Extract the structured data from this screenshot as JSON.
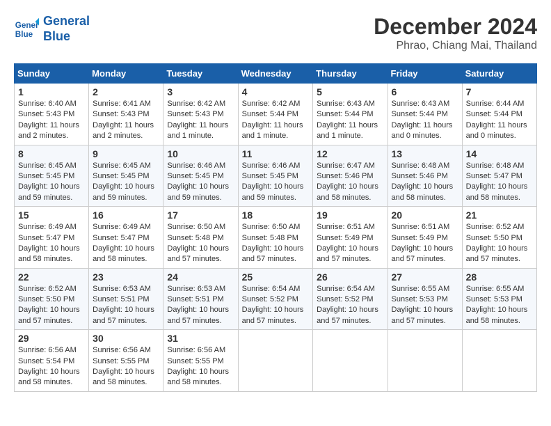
{
  "header": {
    "logo_line1": "General",
    "logo_line2": "Blue",
    "title": "December 2024",
    "subtitle": "Phrao, Chiang Mai, Thailand"
  },
  "weekdays": [
    "Sunday",
    "Monday",
    "Tuesday",
    "Wednesday",
    "Thursday",
    "Friday",
    "Saturday"
  ],
  "weeks": [
    [
      {
        "day": "1",
        "sunrise": "6:40 AM",
        "sunset": "5:43 PM",
        "daylight": "11 hours and 2 minutes."
      },
      {
        "day": "2",
        "sunrise": "6:41 AM",
        "sunset": "5:43 PM",
        "daylight": "11 hours and 2 minutes."
      },
      {
        "day": "3",
        "sunrise": "6:42 AM",
        "sunset": "5:43 PM",
        "daylight": "11 hours and 1 minute."
      },
      {
        "day": "4",
        "sunrise": "6:42 AM",
        "sunset": "5:44 PM",
        "daylight": "11 hours and 1 minute."
      },
      {
        "day": "5",
        "sunrise": "6:43 AM",
        "sunset": "5:44 PM",
        "daylight": "11 hours and 1 minute."
      },
      {
        "day": "6",
        "sunrise": "6:43 AM",
        "sunset": "5:44 PM",
        "daylight": "11 hours and 0 minutes."
      },
      {
        "day": "7",
        "sunrise": "6:44 AM",
        "sunset": "5:44 PM",
        "daylight": "11 hours and 0 minutes."
      }
    ],
    [
      {
        "day": "8",
        "sunrise": "6:45 AM",
        "sunset": "5:45 PM",
        "daylight": "10 hours and 59 minutes."
      },
      {
        "day": "9",
        "sunrise": "6:45 AM",
        "sunset": "5:45 PM",
        "daylight": "10 hours and 59 minutes."
      },
      {
        "day": "10",
        "sunrise": "6:46 AM",
        "sunset": "5:45 PM",
        "daylight": "10 hours and 59 minutes."
      },
      {
        "day": "11",
        "sunrise": "6:46 AM",
        "sunset": "5:45 PM",
        "daylight": "10 hours and 59 minutes."
      },
      {
        "day": "12",
        "sunrise": "6:47 AM",
        "sunset": "5:46 PM",
        "daylight": "10 hours and 58 minutes."
      },
      {
        "day": "13",
        "sunrise": "6:48 AM",
        "sunset": "5:46 PM",
        "daylight": "10 hours and 58 minutes."
      },
      {
        "day": "14",
        "sunrise": "6:48 AM",
        "sunset": "5:47 PM",
        "daylight": "10 hours and 58 minutes."
      }
    ],
    [
      {
        "day": "15",
        "sunrise": "6:49 AM",
        "sunset": "5:47 PM",
        "daylight": "10 hours and 58 minutes."
      },
      {
        "day": "16",
        "sunrise": "6:49 AM",
        "sunset": "5:47 PM",
        "daylight": "10 hours and 58 minutes."
      },
      {
        "day": "17",
        "sunrise": "6:50 AM",
        "sunset": "5:48 PM",
        "daylight": "10 hours and 57 minutes."
      },
      {
        "day": "18",
        "sunrise": "6:50 AM",
        "sunset": "5:48 PM",
        "daylight": "10 hours and 57 minutes."
      },
      {
        "day": "19",
        "sunrise": "6:51 AM",
        "sunset": "5:49 PM",
        "daylight": "10 hours and 57 minutes."
      },
      {
        "day": "20",
        "sunrise": "6:51 AM",
        "sunset": "5:49 PM",
        "daylight": "10 hours and 57 minutes."
      },
      {
        "day": "21",
        "sunrise": "6:52 AM",
        "sunset": "5:50 PM",
        "daylight": "10 hours and 57 minutes."
      }
    ],
    [
      {
        "day": "22",
        "sunrise": "6:52 AM",
        "sunset": "5:50 PM",
        "daylight": "10 hours and 57 minutes."
      },
      {
        "day": "23",
        "sunrise": "6:53 AM",
        "sunset": "5:51 PM",
        "daylight": "10 hours and 57 minutes."
      },
      {
        "day": "24",
        "sunrise": "6:53 AM",
        "sunset": "5:51 PM",
        "daylight": "10 hours and 57 minutes."
      },
      {
        "day": "25",
        "sunrise": "6:54 AM",
        "sunset": "5:52 PM",
        "daylight": "10 hours and 57 minutes."
      },
      {
        "day": "26",
        "sunrise": "6:54 AM",
        "sunset": "5:52 PM",
        "daylight": "10 hours and 57 minutes."
      },
      {
        "day": "27",
        "sunrise": "6:55 AM",
        "sunset": "5:53 PM",
        "daylight": "10 hours and 57 minutes."
      },
      {
        "day": "28",
        "sunrise": "6:55 AM",
        "sunset": "5:53 PM",
        "daylight": "10 hours and 58 minutes."
      }
    ],
    [
      {
        "day": "29",
        "sunrise": "6:56 AM",
        "sunset": "5:54 PM",
        "daylight": "10 hours and 58 minutes."
      },
      {
        "day": "30",
        "sunrise": "6:56 AM",
        "sunset": "5:55 PM",
        "daylight": "10 hours and 58 minutes."
      },
      {
        "day": "31",
        "sunrise": "6:56 AM",
        "sunset": "5:55 PM",
        "daylight": "10 hours and 58 minutes."
      },
      null,
      null,
      null,
      null
    ]
  ]
}
